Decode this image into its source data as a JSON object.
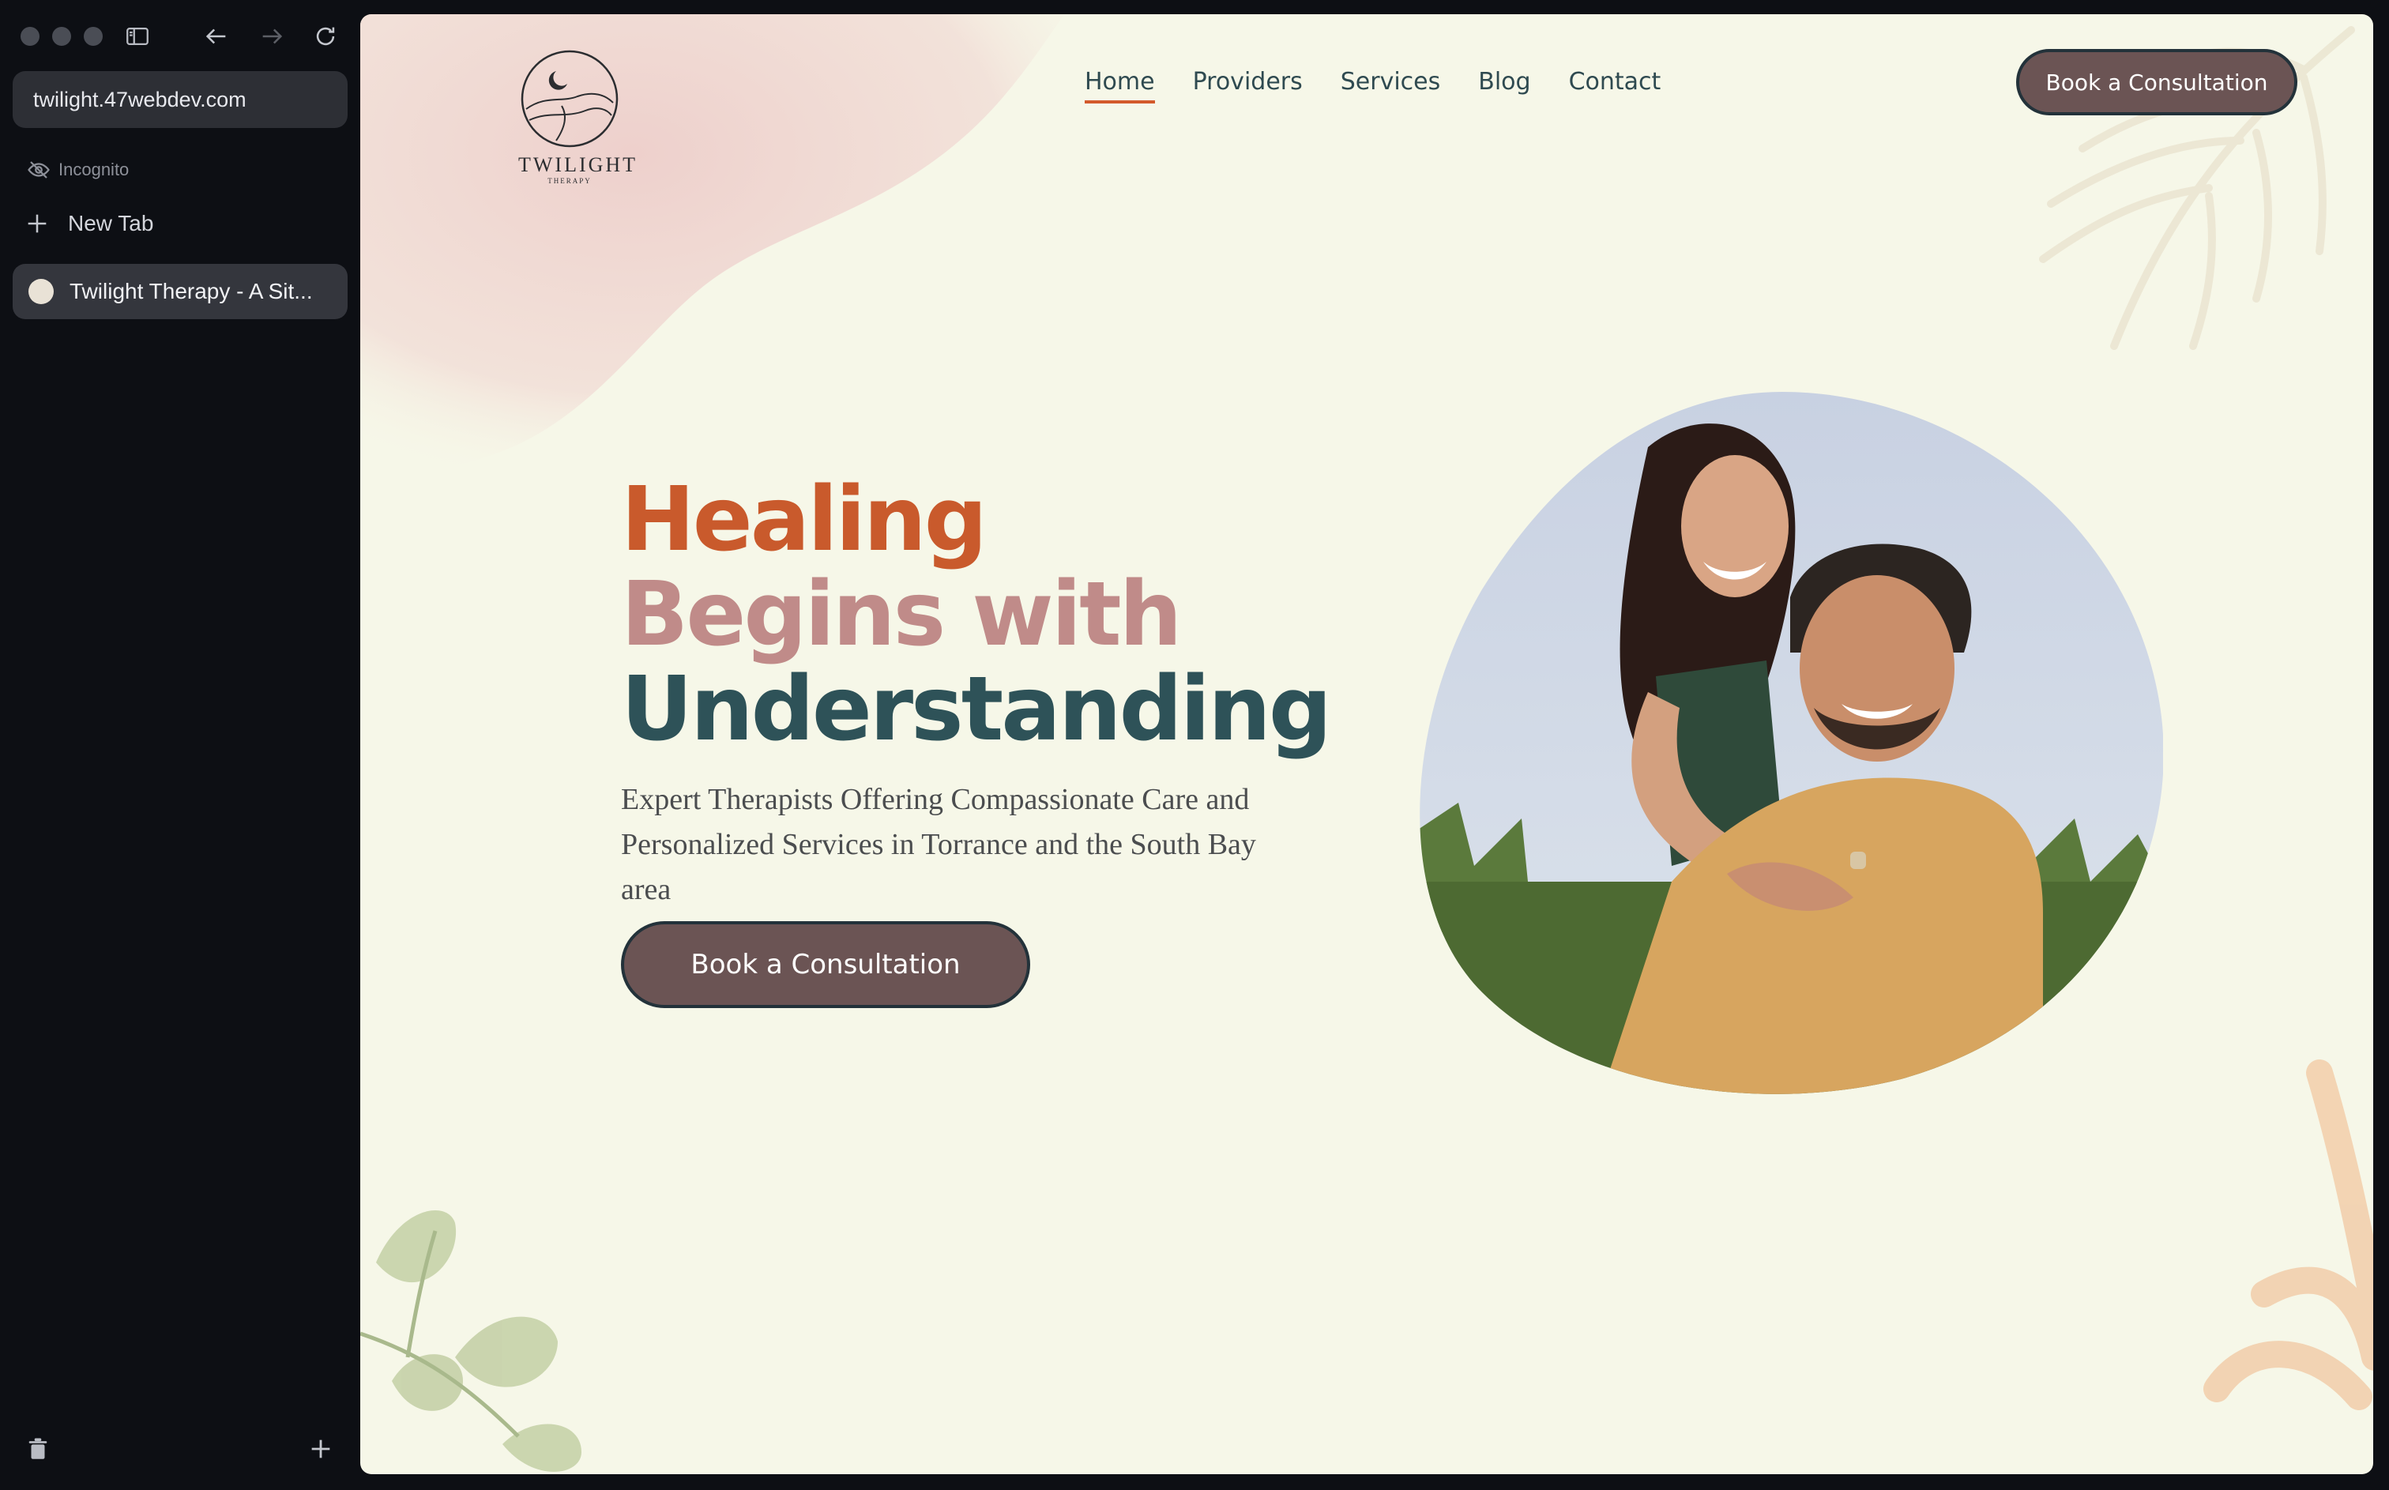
{
  "browser": {
    "url": "twilight.47webdev.com",
    "incognito_label": "Incognito",
    "new_tab_label": "New Tab",
    "tabs": [
      {
        "title": "Twilight Therapy - A Sit..."
      }
    ]
  },
  "site": {
    "logo": {
      "brand": "TWILIGHT",
      "sub": "THERAPY"
    },
    "nav": [
      {
        "label": "Home",
        "active": true
      },
      {
        "label": "Providers"
      },
      {
        "label": "Services"
      },
      {
        "label": "Blog"
      },
      {
        "label": "Contact"
      }
    ],
    "header_cta": "Book a Consultation",
    "hero": {
      "line1": "Healing",
      "line2": "Begins with",
      "line3": "Understanding",
      "subtitle": "Expert Therapists Offering Compassionate Care and Personalized Services in Torrance and the South Bay area",
      "cta": "Book a Consultation"
    }
  },
  "colors": {
    "page_bg": "#f6f7e8",
    "accent_orange": "#c95a2c",
    "accent_rose": "#c08b89",
    "accent_teal": "#2e5258",
    "button_bg": "#6b5454"
  }
}
